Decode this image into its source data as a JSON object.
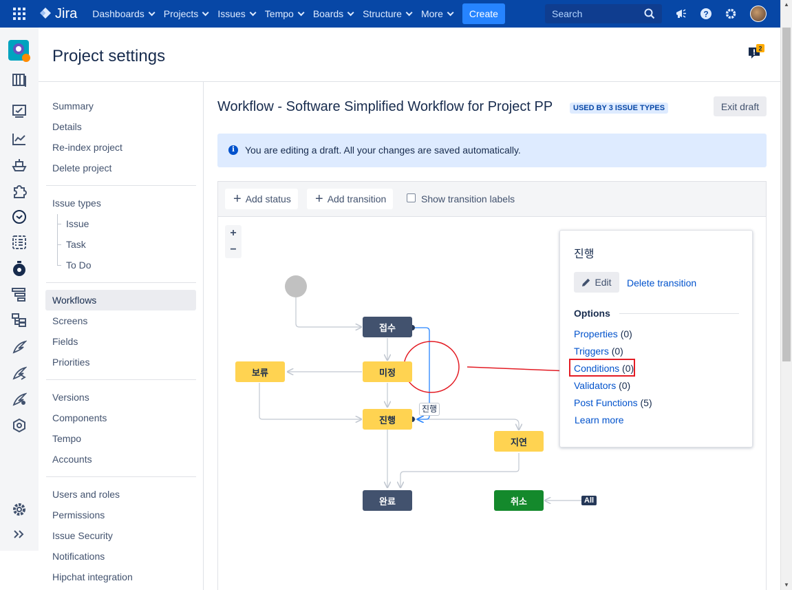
{
  "topnav": {
    "logo": "Jira",
    "items": [
      {
        "label": "Dashboards"
      },
      {
        "label": "Projects"
      },
      {
        "label": "Issues"
      },
      {
        "label": "Tempo"
      },
      {
        "label": "Boards"
      },
      {
        "label": "Structure"
      },
      {
        "label": "More"
      }
    ],
    "create_label": "Create",
    "search_placeholder": "Search"
  },
  "page": {
    "title": "Project settings",
    "feedback_count": "2"
  },
  "sidenav": {
    "group1": [
      "Summary",
      "Details",
      "Re-index project",
      "Delete project"
    ],
    "issue_types": "Issue types",
    "issue_type_items": [
      "Issue",
      "Task",
      "To Do"
    ],
    "group3": [
      "Workflows",
      "Screens",
      "Fields",
      "Priorities"
    ],
    "group4": [
      "Versions",
      "Components",
      "Tempo",
      "Accounts"
    ],
    "group5": [
      "Users and roles",
      "Permissions",
      "Issue Security",
      "Notifications",
      "Hipchat integration"
    ]
  },
  "workflow": {
    "title": "Workflow - Software Simplified Workflow for Project PP",
    "badge": "USED BY 3 ISSUE TYPES",
    "exit_label": "Exit draft",
    "info": "You are editing a draft. All your changes are saved automatically.",
    "add_status": "Add status",
    "add_transition": "Add transition",
    "show_labels": "Show transition labels",
    "zoom_in": "+",
    "zoom_out": "−"
  },
  "diagram": {
    "nodes": {
      "n1": "접수",
      "n2": "미정",
      "n3": "보류",
      "n4": "진행",
      "n5": "지연",
      "n6": "완료",
      "n7": "취소"
    },
    "transition_label": "진행",
    "all_label": "All"
  },
  "panel": {
    "title": "진행",
    "edit_label": "Edit",
    "delete_label": "Delete transition",
    "options_heading": "Options",
    "options": [
      {
        "label": "Properties",
        "count": "(0)"
      },
      {
        "label": "Triggers",
        "count": "(0)"
      },
      {
        "label": "Conditions",
        "count": "(0)"
      },
      {
        "label": "Validators",
        "count": "(0)"
      },
      {
        "label": "Post Functions",
        "count": "(5)"
      }
    ],
    "learn_more": "Learn more"
  },
  "colors": {
    "nav_bg": "#0747A6",
    "status_done": "#42526E",
    "status_progress": "#FFD351",
    "status_green": "#14892C",
    "annotation_red": "#E31B23"
  }
}
